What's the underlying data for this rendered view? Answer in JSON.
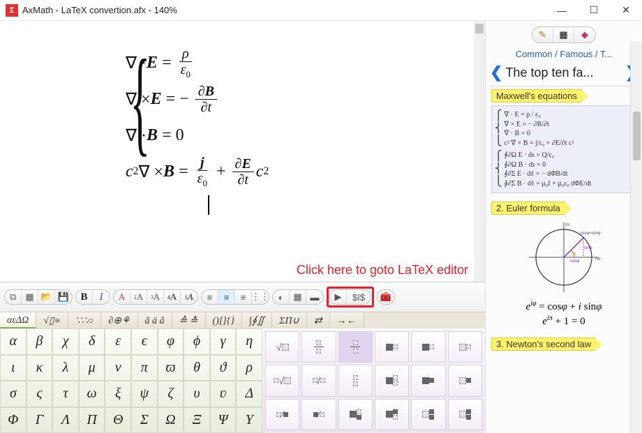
{
  "window": {
    "app": "AxMath",
    "title": "AxMath - LaTeX convertion.afx - 140%",
    "zoom": "140%",
    "file": "LaTeX convertion.afx"
  },
  "hint_text": "Click here to goto LaTeX editor",
  "equations": {
    "row1": "∇ · E = ρ / ε₀",
    "row2": "∇ × E = − ∂B / ∂t",
    "row3": "∇ · B = 0",
    "row4": "c² ∇ × B = j / ε₀ + (∂E / ∂t) c²"
  },
  "toolbar": {
    "bold": "B",
    "italic": "I",
    "font_styles": [
      "A",
      "A",
      "A",
      "A",
      "A"
    ],
    "latex_btn": "$I$"
  },
  "symbol_tabs": [
    "αεΔΩ",
    "√▯≡",
    "∵∴○",
    "∂⊕⚘",
    "â ä ã",
    "≙ ≛",
    "()[]{}",
    "∫∮∬",
    "ΣΠ∪",
    "⇄",
    "→←"
  ],
  "greek": {
    "rows": [
      [
        "α",
        "β",
        "χ",
        "δ",
        "ε",
        "ϵ",
        "φ",
        "ϕ",
        "γ",
        "η"
      ],
      [
        "ι",
        "κ",
        "λ",
        "μ",
        "ν",
        "π",
        "ϖ",
        "θ",
        "ϑ",
        "ρ"
      ],
      [
        "σ",
        "ς",
        "τ",
        "ω",
        "ξ",
        "ψ",
        "ζ",
        "υ",
        "ʋ",
        "Δ"
      ],
      [
        "Φ",
        "Γ",
        "Λ",
        "Π",
        "Θ",
        "Σ",
        "Ω",
        "Ξ",
        "Ψ",
        "Υ"
      ]
    ]
  },
  "struct_labels": [
    "√▯",
    "frac-v",
    "frac-v-sel",
    "sup",
    "sup-box",
    "sub",
    "sub-box",
    "nth-root",
    "slash-frac",
    "stack",
    "supsub",
    "supsub2",
    "box-slash",
    "blk-slash",
    "mixed1",
    "mixed2",
    "mixed3",
    "mixed4"
  ],
  "sidebar": {
    "breadcrumb": "Common / Famous / T...",
    "nav_title": "The top ten fa...",
    "sections": [
      {
        "label": "Maxwell's equations"
      },
      {
        "label": "2. Euler formula",
        "eq1": "e^{iφ} = cosφ + i sinφ",
        "eq2": "e^{iπ} + 1 = 0"
      },
      {
        "label": "3. Newton's second law"
      }
    ],
    "maxwell_preview": [
      "∇ · E = ρ / ε₀",
      "∇ × E = − ∂B/∂t",
      "∇ · B = 0",
      "c² ∇ × B = j/ε₀ + ∂E/∂t c²",
      "∮∂Ω E · ds = Q/ε₀",
      "∮∂Ω B · ds = 0",
      "∮∂Σ E · dℓ = − dΦB/dt",
      "∮∂Σ B · dℓ = μ₀I + μ₀ε₀ dΦE/dt"
    ]
  },
  "icons": {
    "minimize": "—",
    "maximize": "☐",
    "close": "✕",
    "prev": "❮",
    "next": "❯"
  }
}
